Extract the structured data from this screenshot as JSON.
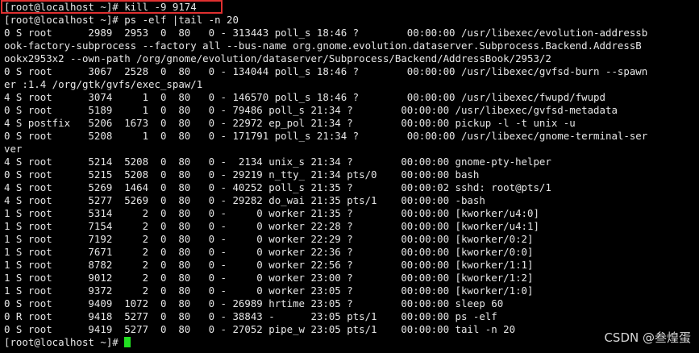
{
  "terminal": {
    "command_line": "[root@localhost ~]# kill -9 9174",
    "lines": [
      "[root@localhost ~]# ps -elf |tail -n 20",
      "0 S root      2989  2953  0  80   0 - 313443 poll_s 18:46 ?        00:00:00 /usr/libexec/evolution-addressb",
      "ook-factory-subprocess --factory all --bus-name org.gnome.evolution.dataserver.Subprocess.Backend.AddressB",
      "ookx2953x2 --own-path /org/gnome/evolution/dataserver/Subprocess/Backend/AddressBook/2953/2",
      "0 S root      3067  2528  0  80   0 - 134044 poll_s 18:46 ?        00:00:00 /usr/libexec/gvfsd-burn --spawn",
      "er :1.4 /org/gtk/gvfs/exec_spaw/1",
      "4 S root      3074     1  0  80   0 - 146570 poll_s 18:46 ?        00:00:00 /usr/libexec/fwupd/fwupd",
      "0 S root      5189     1  0  80   0 - 79486 poll_s 21:34 ?        00:00:00 /usr/libexec/gvfsd-metadata",
      "4 S postfix   5206  1673  0  80   0 - 22972 ep_pol 21:34 ?        00:00:00 pickup -l -t unix -u",
      "0 S root      5208     1  0  80   0 - 171791 poll_s 21:34 ?        00:00:00 /usr/libexec/gnome-terminal-ser",
      "ver",
      "4 S root      5214  5208  0  80   0 -  2134 unix_s 21:34 ?        00:00:00 gnome-pty-helper",
      "0 S root      5215  5208  0  80   0 - 29219 n_tty_ 21:34 pts/0    00:00:00 bash",
      "4 S root      5269  1464  0  80   0 - 40252 poll_s 21:35 ?        00:00:02 sshd: root@pts/1",
      "4 S root      5277  5269  0  80   0 - 29282 do_wai 21:35 pts/1    00:00:00 -bash",
      "1 S root      5314     2  0  80   0 -     0 worker 21:35 ?        00:00:00 [kworker/u4:0]",
      "1 S root      7154     2  0  80   0 -     0 worker 22:28 ?        00:00:00 [kworker/u4:1]",
      "1 S root      7192     2  0  80   0 -     0 worker 22:29 ?        00:00:00 [kworker/0:2]",
      "1 S root      7671     2  0  80   0 -     0 worker 22:36 ?        00:00:00 [kworker/0:0]",
      "1 S root      8782     2  0  80   0 -     0 worker 22:56 ?        00:00:00 [kworker/1:1]",
      "1 S root      9012     2  0  80   0 -     0 worker 23:00 ?        00:00:00 [kworker/1:2]",
      "1 S root      9372     2  0  80   0 -     0 worker 23:05 ?        00:00:00 [kworker/1:0]",
      "0 S root      9409  1072  0  80   0 - 26989 hrtime 23:05 ?        00:00:00 sleep 60",
      "0 R root      9418  5277  0  80   0 - 38843 -      23:05 pts/1    00:00:00 ps -elf",
      "0 S root      9419  5277  0  80   0 - 27052 pipe_w 23:05 pts/1    00:00:00 tail -n 20"
    ],
    "prompt": "[root@localhost ~]# ",
    "colors": {
      "background": "#000000",
      "text": "#e6e6e6",
      "highlight_border": "#e03030",
      "cursor": "#22e022"
    }
  },
  "watermark": "CSDN @叁煌蛋"
}
